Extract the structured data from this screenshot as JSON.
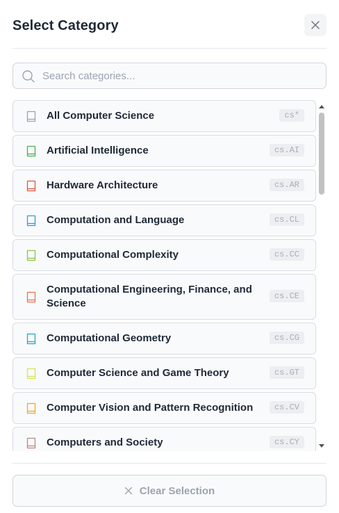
{
  "modal": {
    "title": "Select Category",
    "close_icon": "close-icon"
  },
  "search": {
    "placeholder": "Search categories...",
    "value": "",
    "icon": "search-icon"
  },
  "categories": [
    {
      "label": "All Computer Science",
      "code": "cs*",
      "color": "#9ca3af"
    },
    {
      "label": "Artificial Intelligence",
      "code": "cs.AI",
      "color": "#4caf50"
    },
    {
      "label": "Hardware Architecture",
      "code": "cs.AR",
      "color": "#e2553f"
    },
    {
      "label": "Computation and Language",
      "code": "cs.CL",
      "color": "#2b9de0"
    },
    {
      "label": "Computational Complexity",
      "code": "cs.CC",
      "color": "#8bc34a"
    },
    {
      "label": "Computational Engineering, Finance, and Science",
      "code": "cs.CE",
      "color": "#f07055"
    },
    {
      "label": "Computational Geometry",
      "code": "cs.CG",
      "color": "#23a8c8"
    },
    {
      "label": "Computer Science and Game Theory",
      "code": "cs.GT",
      "color": "#d7e25a"
    },
    {
      "label": "Computer Vision and Pattern Recognition",
      "code": "cs.CV",
      "color": "#f5a524"
    },
    {
      "label": "Computers and Society",
      "code": "cs.CY",
      "color": "#b88a82"
    }
  ],
  "footer": {
    "clear_label": "Clear Selection",
    "clear_icon": "x-icon"
  }
}
